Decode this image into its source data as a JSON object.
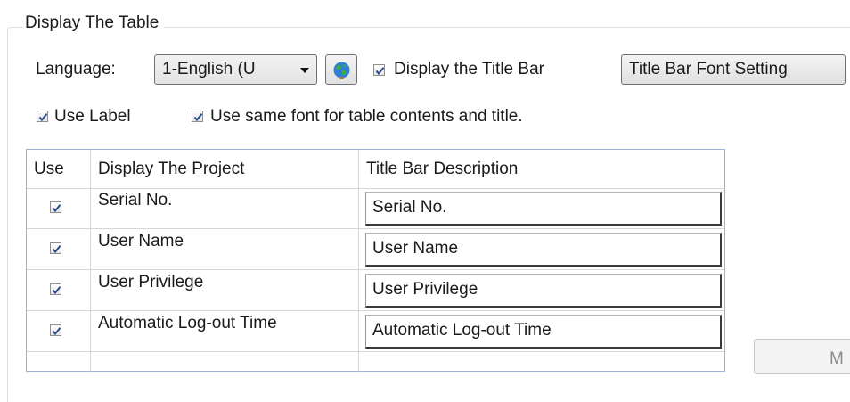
{
  "groupbox": {
    "title": "Display The Table"
  },
  "language": {
    "label": "Language:",
    "selected": "1-English (U"
  },
  "title_bar": {
    "display_label": "Display the Title Bar",
    "display_checked": true,
    "font_button_label": "Title Bar Font Setting"
  },
  "options": {
    "use_label": "Use Label",
    "use_label_checked": true,
    "same_font": "Use same font for table contents and title.",
    "same_font_checked": true
  },
  "table": {
    "headers": [
      "Use",
      "Display The Project",
      "Title Bar Description"
    ],
    "rows": [
      {
        "use": true,
        "project": "Serial No.",
        "description": "Serial No."
      },
      {
        "use": true,
        "project": "User Name",
        "description": "User Name"
      },
      {
        "use": true,
        "project": "User Privilege",
        "description": "User Privilege"
      },
      {
        "use": true,
        "project": "Automatic Log-out Time",
        "description": "Automatic Log-out Time"
      }
    ]
  },
  "partial_button": {
    "label": "M"
  },
  "icons": {
    "globe": "globe-icon",
    "checkmark": "checkmark-icon",
    "dropdown": "chevron-down-icon"
  },
  "colors": {
    "check": "#2b4a8a",
    "grid_border": "#99b4d1"
  }
}
